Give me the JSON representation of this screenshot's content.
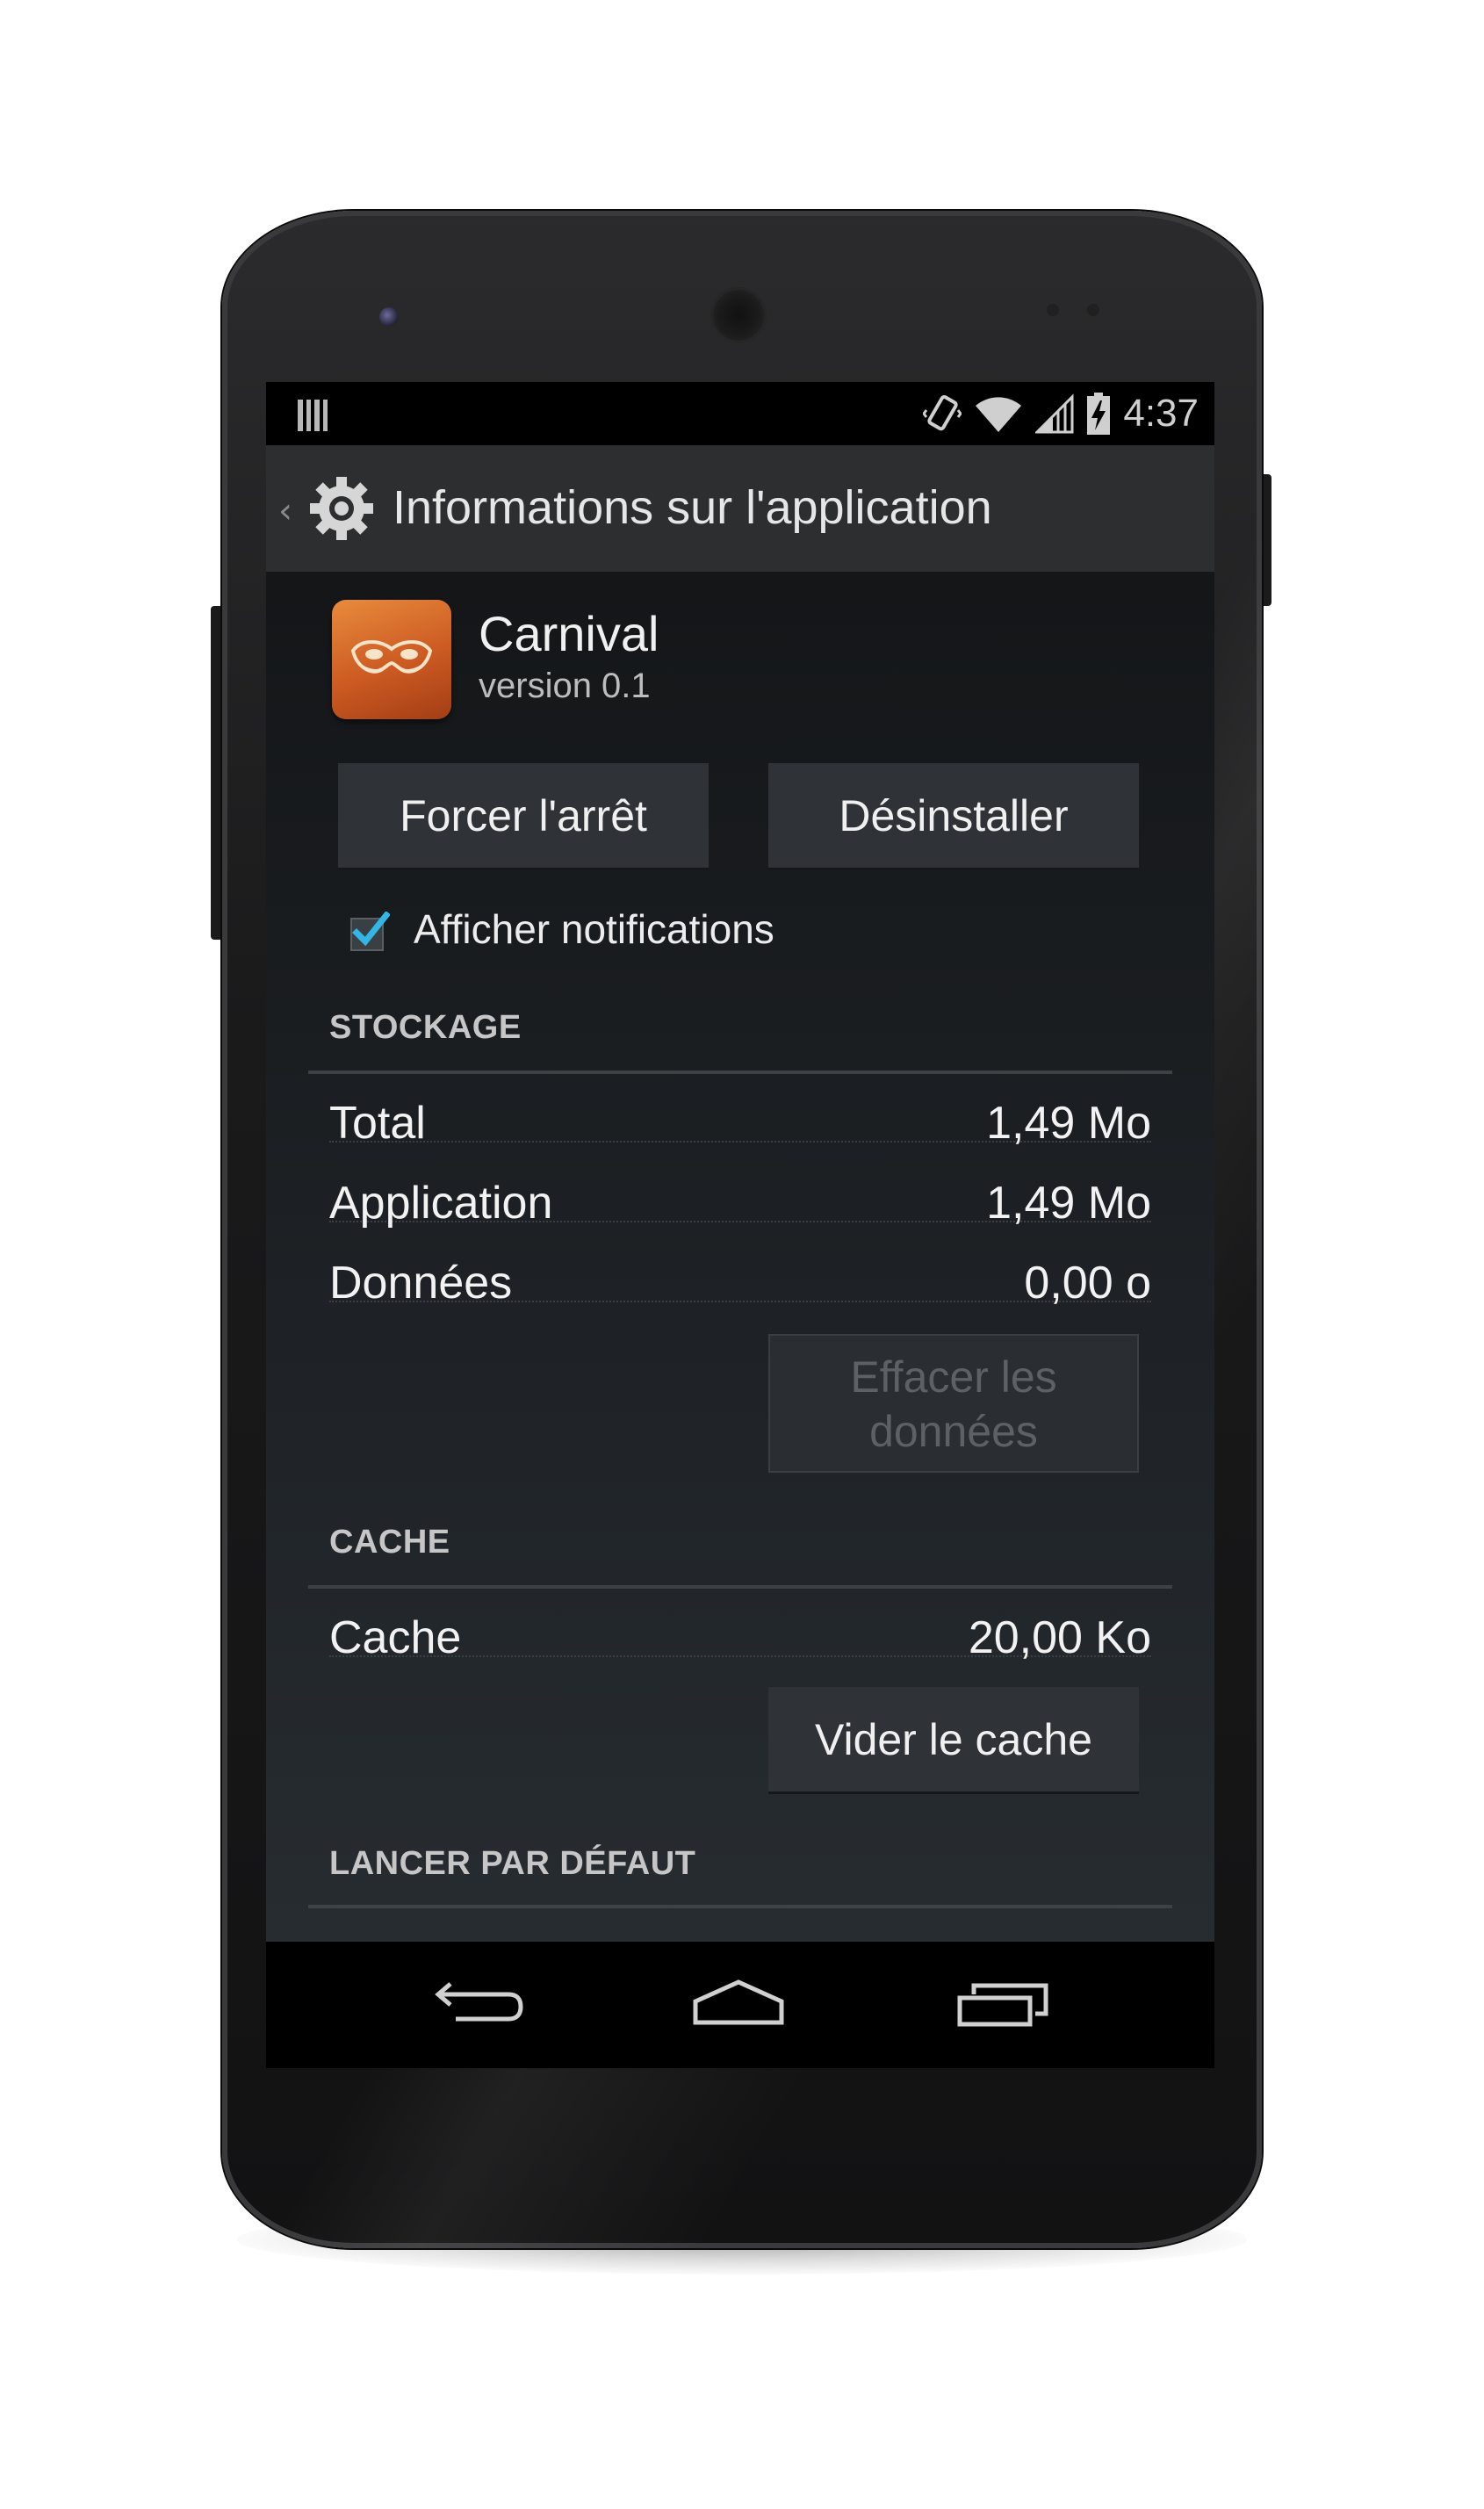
{
  "status_bar": {
    "time": "4:37",
    "icons": [
      "notification-bars-icon",
      "vibrate-icon",
      "wifi-icon",
      "signal-icon",
      "battery-charging-icon"
    ]
  },
  "action_bar": {
    "back_caret": "‹",
    "icon": "settings-gear-icon",
    "title": "Informations sur l'application"
  },
  "app": {
    "name": "Carnival",
    "version": "version 0.1",
    "icon": "carnival-mask-icon",
    "icon_color": "#d86a2a"
  },
  "buttons": {
    "force_stop": "Forcer l'arrêt",
    "uninstall": "Désinstaller",
    "clear_data": "Effacer les données",
    "clear_cache": "Vider le cache"
  },
  "notifications": {
    "label": "Afficher notifications",
    "checked": true,
    "check_color": "#33b5e5"
  },
  "storage": {
    "title": "STOCKAGE",
    "rows": [
      {
        "label": "Total",
        "value": "1,49 Mo"
      },
      {
        "label": "Application",
        "value": "1,49 Mo"
      },
      {
        "label": "Données",
        "value": "0,00 o"
      }
    ]
  },
  "cache": {
    "title": "CACHE",
    "rows": [
      {
        "label": "Cache",
        "value": "20,00 Ko"
      }
    ]
  },
  "launch_default": {
    "title": "LANCER PAR DÉFAUT"
  },
  "nav_bar": {
    "icons": [
      "back-icon",
      "home-icon",
      "recent-apps-icon"
    ]
  }
}
